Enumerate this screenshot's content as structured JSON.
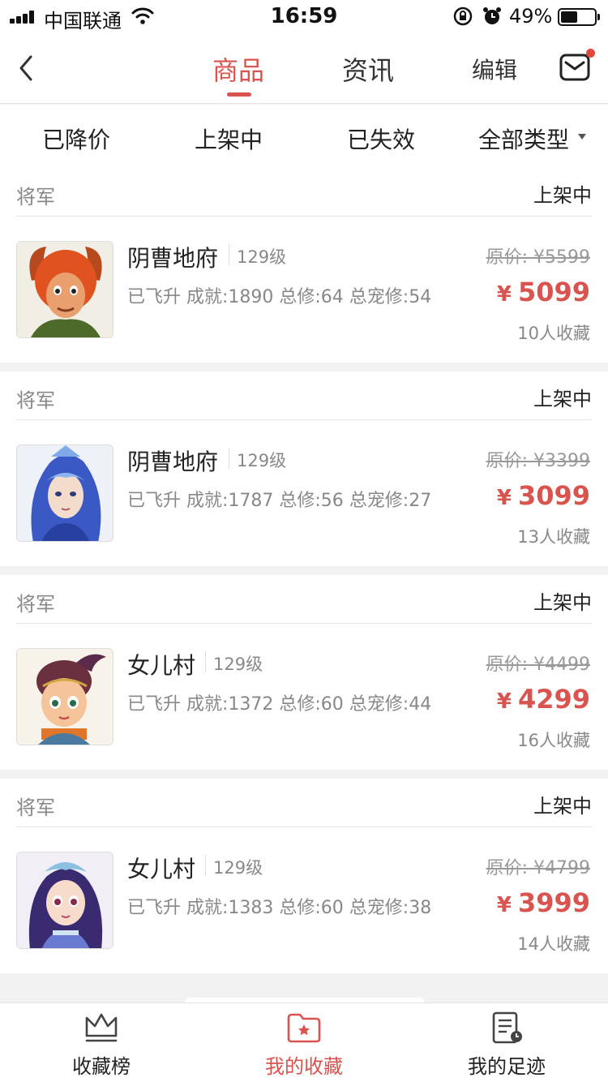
{
  "status_bar": {
    "carrier": "中国联通",
    "time": "16:59",
    "battery": "49%"
  },
  "header": {
    "tabs": [
      {
        "label": "商品",
        "active": true
      },
      {
        "label": "资讯",
        "active": false
      }
    ],
    "edit_label": "编辑",
    "accent_color": "#d9534f"
  },
  "filters": [
    "已降价",
    "上架中",
    "已失效",
    "全部类型"
  ],
  "items": [
    {
      "category": "将军",
      "status": "上架中",
      "name": "阴曹地府",
      "level": "129级",
      "stats": "已飞升 成就:1890 总修:64 总宠修:54",
      "original_price": "原价: ¥5599",
      "currency": "¥",
      "price": "5099",
      "favorites": "10人收藏"
    },
    {
      "category": "将军",
      "status": "上架中",
      "name": "阴曹地府",
      "level": "129级",
      "stats": "已飞升 成就:1787 总修:56 总宠修:27",
      "original_price": "原价: ¥3399",
      "currency": "¥",
      "price": "3099",
      "favorites": "13人收藏"
    },
    {
      "category": "将军",
      "status": "上架中",
      "name": "女儿村",
      "level": "129级",
      "stats": "已飞升 成就:1372 总修:60 总宠修:44",
      "original_price": "原价: ¥4499",
      "currency": "¥",
      "price": "4299",
      "favorites": "16人收藏"
    },
    {
      "category": "将军",
      "status": "上架中",
      "name": "女儿村",
      "level": "129级",
      "stats": "已飞升 成就:1383 总修:60 总宠修:38",
      "original_price": "原价: ¥4799",
      "currency": "¥",
      "price": "3999",
      "favorites": "14人收藏"
    }
  ],
  "bottom_tabs": [
    {
      "label": "收藏榜",
      "icon": "crown-icon",
      "active": false
    },
    {
      "label": "我的收藏",
      "icon": "favorite-folder-icon",
      "active": true
    },
    {
      "label": "我的足迹",
      "icon": "history-icon",
      "active": false
    }
  ]
}
